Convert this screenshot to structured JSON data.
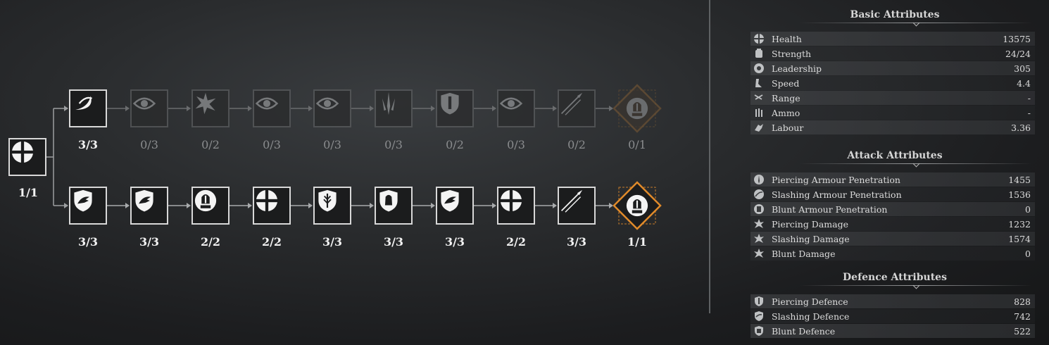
{
  "tree": {
    "root": {
      "count": "1/1",
      "icon": "cross-shield-icon"
    },
    "top_row": [
      {
        "count": "3/3",
        "icon": "crescent-slash-icon",
        "locked": false
      },
      {
        "count": "0/3",
        "icon": "eye-icon",
        "locked": true
      },
      {
        "count": "0/2",
        "icon": "burst-icon",
        "locked": true
      },
      {
        "count": "0/3",
        "icon": "eye-icon",
        "locked": true
      },
      {
        "count": "0/3",
        "icon": "eye-icon",
        "locked": true
      },
      {
        "count": "0/3",
        "icon": "blades-icon",
        "locked": true
      },
      {
        "count": "0/2",
        "icon": "shield-emblem-icon",
        "locked": true
      },
      {
        "count": "0/3",
        "icon": "eye-icon",
        "locked": true
      },
      {
        "count": "0/2",
        "icon": "spears-icon",
        "locked": true
      },
      {
        "count": "0/1",
        "icon": "knight-diamond-icon",
        "locked": true
      }
    ],
    "bottom_row": [
      {
        "count": "3/3",
        "icon": "shield-wing-icon",
        "locked": false
      },
      {
        "count": "3/3",
        "icon": "shield-wing-icon",
        "locked": false
      },
      {
        "count": "2/2",
        "icon": "knight-helmet-icon",
        "locked": false
      },
      {
        "count": "2/2",
        "icon": "cross-circle-icon",
        "locked": false
      },
      {
        "count": "3/3",
        "icon": "shield-arrow-icon",
        "locked": false
      },
      {
        "count": "3/3",
        "icon": "shield-bell-icon",
        "locked": false
      },
      {
        "count": "3/3",
        "icon": "shield-wing-icon",
        "locked": false
      },
      {
        "count": "2/2",
        "icon": "cross-circle-icon",
        "locked": false
      },
      {
        "count": "3/3",
        "icon": "spears-icon",
        "locked": false
      },
      {
        "count": "1/1",
        "icon": "knight-diamond-icon",
        "locked": false
      }
    ]
  },
  "colors": {
    "accent_orange": "#e08a2a",
    "locked_orange": "#6e5334"
  },
  "attributes": {
    "basic": {
      "title": "Basic Attributes",
      "rows": [
        {
          "label": "Health",
          "value": "13575",
          "icon": "health-icon"
        },
        {
          "label": "Strength",
          "value": "24/24",
          "icon": "strength-icon"
        },
        {
          "label": "Leadership",
          "value": "305",
          "icon": "leadership-icon"
        },
        {
          "label": "Speed",
          "value": "4.4",
          "icon": "speed-icon"
        },
        {
          "label": "Range",
          "value": "-",
          "icon": "range-icon"
        },
        {
          "label": "Ammo",
          "value": "-",
          "icon": "ammo-icon"
        },
        {
          "label": "Labour",
          "value": "3.36",
          "icon": "labour-icon"
        }
      ]
    },
    "attack": {
      "title": "Attack Attributes",
      "rows": [
        {
          "label": "Piercing Armour Penetration",
          "value": "1455",
          "icon": "piercing-penetration-icon"
        },
        {
          "label": "Slashing Armour Penetration",
          "value": "1536",
          "icon": "slashing-penetration-icon"
        },
        {
          "label": "Blunt Armour Penetration",
          "value": "0",
          "icon": "blunt-penetration-icon"
        },
        {
          "label": "Piercing Damage",
          "value": "1232",
          "icon": "piercing-damage-icon"
        },
        {
          "label": "Slashing Damage",
          "value": "1574",
          "icon": "slashing-damage-icon"
        },
        {
          "label": "Blunt Damage",
          "value": "0",
          "icon": "blunt-damage-icon"
        }
      ]
    },
    "defence": {
      "title": "Defence Attributes",
      "rows": [
        {
          "label": "Piercing Defence",
          "value": "828",
          "icon": "piercing-defence-icon"
        },
        {
          "label": "Slashing Defence",
          "value": "742",
          "icon": "slashing-defence-icon"
        },
        {
          "label": "Blunt Defence",
          "value": "522",
          "icon": "blunt-defence-icon"
        }
      ]
    }
  }
}
